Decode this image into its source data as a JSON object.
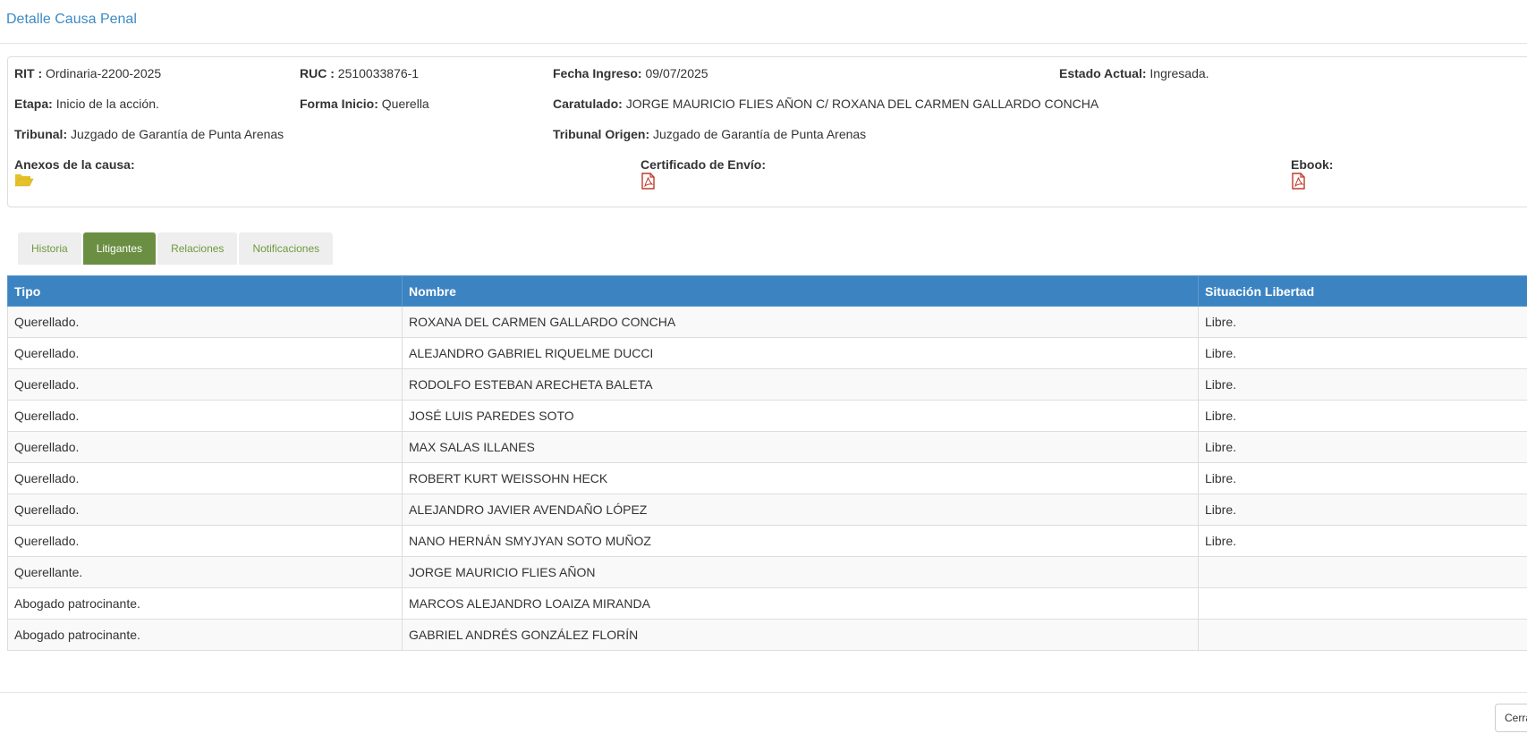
{
  "modal": {
    "title": "Detalle Causa Penal",
    "close_label": "Cerrar"
  },
  "info": {
    "rit": {
      "label": "RIT :",
      "value": "Ordinaria-2200-2025"
    },
    "ruc": {
      "label": "RUC :",
      "value": "2510033876-1"
    },
    "fecha_ingreso": {
      "label": "Fecha Ingreso:",
      "value": "09/07/2025"
    },
    "estado_actual": {
      "label": "Estado Actual:",
      "value": "Ingresada."
    },
    "etapa": {
      "label": "Etapa:",
      "value": "Inicio de la acción."
    },
    "forma_inicio": {
      "label": "Forma Inicio:",
      "value": "Querella"
    },
    "caratulado": {
      "label": "Caratulado:",
      "value": "JORGE MAURICIO FLIES AÑON C/ ROXANA DEL CARMEN GALLARDO CONCHA"
    },
    "tribunal": {
      "label": "Tribunal:",
      "value": "Juzgado de Garantía de Punta Arenas"
    },
    "tribunal_origen": {
      "label": "Tribunal Origen:",
      "value": "Juzgado de Garantía de Punta Arenas"
    },
    "anexos": {
      "label": "Anexos de la causa:",
      "icon": "folder-open-icon"
    },
    "certificado": {
      "label": "Certificado de Envío:",
      "icon": "pdf-icon"
    },
    "ebook": {
      "label": "Ebook:",
      "icon": "pdf-icon"
    }
  },
  "tabs": [
    {
      "label": "Historia",
      "active": false
    },
    {
      "label": "Litigantes",
      "active": true
    },
    {
      "label": "Relaciones",
      "active": false
    },
    {
      "label": "Notificaciones",
      "active": false
    }
  ],
  "table": {
    "headers": [
      "Tipo",
      "Nombre",
      "Situación Libertad"
    ],
    "rows": [
      [
        "Querellado.",
        "ROXANA DEL CARMEN GALLARDO CONCHA",
        "Libre."
      ],
      [
        "Querellado.",
        "ALEJANDRO GABRIEL RIQUELME DUCCI",
        "Libre."
      ],
      [
        "Querellado.",
        "RODOLFO ESTEBAN ARECHETA BALETA",
        "Libre."
      ],
      [
        "Querellado.",
        "JOSÉ LUIS PAREDES SOTO",
        "Libre."
      ],
      [
        "Querellado.",
        "MAX SALAS ILLANES",
        "Libre."
      ],
      [
        "Querellado.",
        "ROBERT KURT WEISSOHN HECK",
        "Libre."
      ],
      [
        "Querellado.",
        "ALEJANDRO JAVIER AVENDAÑO LÓPEZ",
        "Libre."
      ],
      [
        "Querellado.",
        "NANO HERNÁN SMYJYAN SOTO MUÑOZ",
        "Libre."
      ],
      [
        "Querellante.",
        "JORGE MAURICIO FLIES AÑON",
        ""
      ],
      [
        "Abogado patrocinante.",
        "MARCOS ALEJANDRO LOAIZA MIRANDA",
        ""
      ],
      [
        "Abogado patrocinante.",
        "GABRIEL ANDRÉS GONZÁLEZ FLORÍN",
        ""
      ]
    ]
  },
  "colors": {
    "title": "#3e8ac4",
    "table_header": "#3c84c1",
    "tab_active": "#6b8f42",
    "tab_text": "#6f9a3f",
    "folder": "#e4c22b",
    "pdf": "#c0392b"
  }
}
